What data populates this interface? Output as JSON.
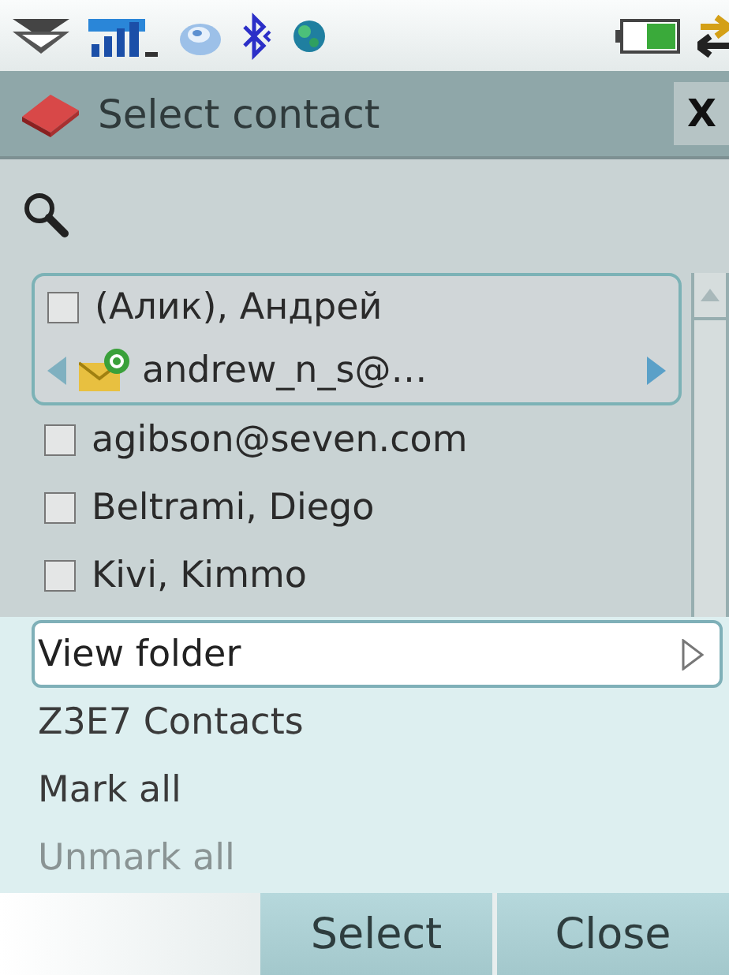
{
  "title": {
    "text": "Select contact",
    "close": "X"
  },
  "contacts": [
    {
      "name": "(Алик), Андрей",
      "checked": false,
      "focused": true,
      "detail": "andrew_n_s@…"
    },
    {
      "name": "agibson@seven.com",
      "checked": false,
      "focused": false
    },
    {
      "name": "Beltrami, Diego",
      "checked": false,
      "focused": false
    },
    {
      "name": "Kivi, Kimmo",
      "checked": false,
      "focused": false
    }
  ],
  "menu": [
    {
      "label": "View folder",
      "selected": true,
      "submenu": true,
      "disabled": false
    },
    {
      "label": "Z3E7 Contacts",
      "selected": false,
      "submenu": false,
      "disabled": false
    },
    {
      "label": "Mark all",
      "selected": false,
      "submenu": false,
      "disabled": false
    },
    {
      "label": "Unmark all",
      "selected": false,
      "submenu": false,
      "disabled": true
    }
  ],
  "softkeys": [
    "Select",
    "Close"
  ]
}
